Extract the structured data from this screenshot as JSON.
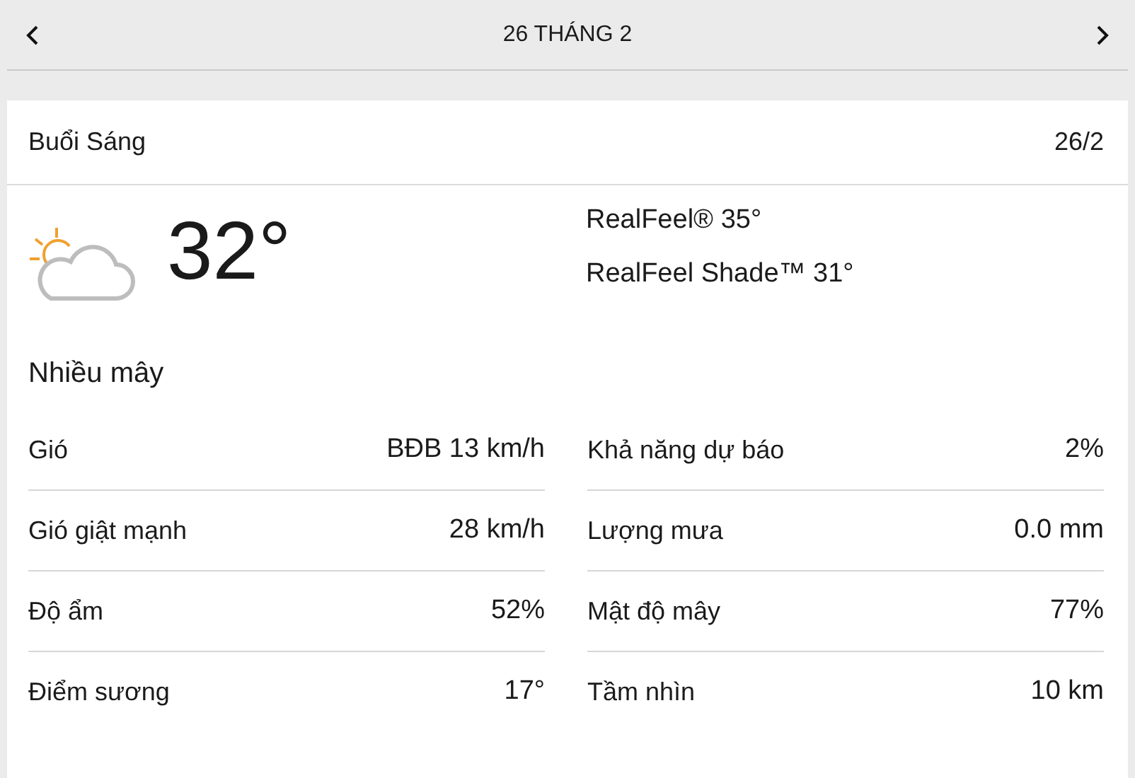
{
  "header": {
    "title": "26 THÁNG 2"
  },
  "card": {
    "period": "Buổi Sáng",
    "date": "26/2",
    "temperature": "32°",
    "realfeel": [
      "RealFeel® 35°",
      "RealFeel Shade™ 31°"
    ],
    "condition": "Nhiều mây",
    "details_left": [
      {
        "label": "Gió",
        "value": "BĐB 13 km/h"
      },
      {
        "label": "Gió giật mạnh",
        "value": "28 km/h"
      },
      {
        "label": "Độ ẩm",
        "value": "52%"
      },
      {
        "label": "Điểm sương",
        "value": "17°"
      }
    ],
    "details_right": [
      {
        "label": "Khả năng dự báo",
        "value": "2%"
      },
      {
        "label": "Lượng mưa",
        "value": "0.0 mm"
      },
      {
        "label": "Mật độ mây",
        "value": "77%"
      },
      {
        "label": "Tầm nhìn",
        "value": "10 km"
      }
    ]
  }
}
